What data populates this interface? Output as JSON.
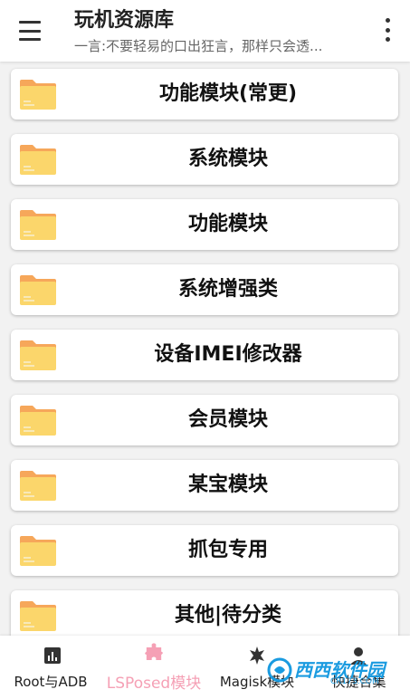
{
  "header": {
    "title": "玩机资源库",
    "subtitle": "一言:不要轻易的口出狂言，那样只会透..."
  },
  "icons": {
    "menu": "hamburger-menu-icon",
    "more": "more-vertical-icon",
    "folder": "folder-icon"
  },
  "colors": {
    "folder_body": "#fbd66b",
    "folder_tab": "#f6a75a",
    "active_tab": "#f5a0b5"
  },
  "cards": [
    {
      "label": "功能模块(常更)"
    },
    {
      "label": "系统模块"
    },
    {
      "label": "功能模块"
    },
    {
      "label": "系统增强类"
    },
    {
      "label": "设备IMEI修改器"
    },
    {
      "label": "会员模块"
    },
    {
      "label": "某宝模块"
    },
    {
      "label": "抓包专用"
    },
    {
      "label": "其他|待分类"
    }
  ],
  "bottom_nav": [
    {
      "label": "Root与ADB",
      "icon": "bar-chart-icon"
    },
    {
      "label": "LSPosed模块",
      "icon": "puzzle-icon",
      "active": true
    },
    {
      "label": "Magisk模块",
      "icon": "magisk-icon"
    },
    {
      "label": "快捷合集",
      "icon": "person-icon"
    }
  ],
  "watermark": {
    "text": "西西软件园",
    "url": "CR173.COM"
  }
}
